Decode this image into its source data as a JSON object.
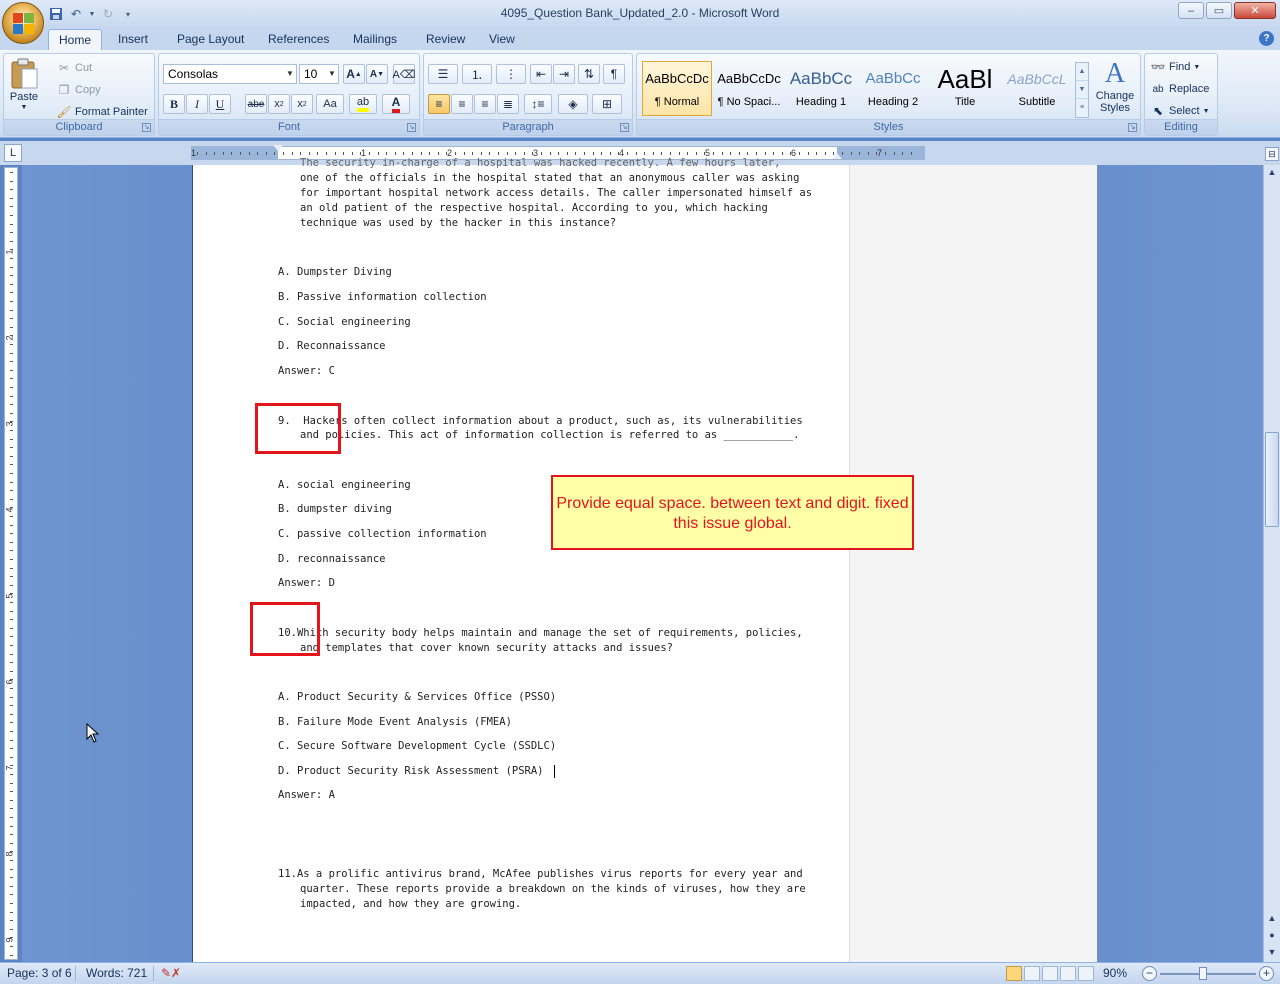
{
  "window": {
    "title": "4095_Question Bank_Updated_2.0 - Microsoft Word",
    "controls": {
      "minimize": "–",
      "restore": "▭",
      "close": "✕"
    }
  },
  "tabs": [
    {
      "label": "Home",
      "active": true
    },
    {
      "label": "Insert"
    },
    {
      "label": "Page Layout"
    },
    {
      "label": "References"
    },
    {
      "label": "Mailings"
    },
    {
      "label": "Review"
    },
    {
      "label": "View"
    }
  ],
  "ribbon": {
    "clipboard": {
      "group_label": "Clipboard",
      "paste": "Paste",
      "cut": "Cut",
      "copy": "Copy",
      "format_painter": "Format Painter"
    },
    "font": {
      "group_label": "Font",
      "font_name": "Consolas",
      "font_size": "10"
    },
    "paragraph": {
      "group_label": "Paragraph"
    },
    "styles": {
      "group_label": "Styles",
      "items": [
        {
          "sample": "AaBbCcDc",
          "name": "¶ Normal",
          "selected": true
        },
        {
          "sample": "AaBbCcDc",
          "name": "¶ No Spaci..."
        },
        {
          "sample": "AaBbCc",
          "name": "Heading 1"
        },
        {
          "sample": "AaBbCc",
          "name": "Heading 2"
        },
        {
          "sample": "AaBl",
          "name": "Title"
        },
        {
          "sample": "AaBbCcL",
          "name": "Subtitle"
        }
      ],
      "change_styles": "Change Styles"
    },
    "editing": {
      "group_label": "Editing",
      "find": "Find",
      "replace": "Replace",
      "select": "Select"
    }
  },
  "ruler": {
    "numbers": [
      "1",
      "1",
      "2",
      "3",
      "4",
      "5",
      "6",
      "7"
    ]
  },
  "document": {
    "q8_lines": [
      "one of the officials in the hospital stated that an anonymous caller was asking",
      "for important hospital network access details. The caller impersonated himself as",
      "an old patient of the respective hospital. According to you, which hacking",
      "technique was used by the hacker in this instance?"
    ],
    "q8_options": [
      "A. Dumpster Diving",
      "B. Passive information collection",
      "C. Social engineering",
      "D. Reconnaissance"
    ],
    "q8_answer": "Answer: C",
    "q9_line1": "9.  Hackers often collect information about a product, such as, its vulnerabilities",
    "q9_line2": "and policies. This act of information collection is referred to as ___________.",
    "q9_options": [
      "A. social engineering",
      "B. dumpster diving",
      "C. passive collection information",
      "D. reconnaissance"
    ],
    "q9_answer": "Answer: D",
    "q10_line1": "10.Which security body helps maintain and manage the set of requirements, policies,",
    "q10_line2": "and templates that cover known security attacks and issues?",
    "q10_options": [
      "A. Product Security & Services Office (PSSO)",
      "B. Failure Mode Event Analysis (FMEA)",
      "C. Secure Software Development Cycle (SSDLC)",
      "D. Product Security Risk Assessment (PSRA)"
    ],
    "q10_answer": "Answer: A",
    "q11_line1": "11.As a prolific antivirus brand, McAfee publishes virus reports for every year and",
    "q11_line2": "quarter. These reports provide a breakdown on the kinds of viruses, how they are",
    "q11_line3": "impacted, and how they are growing."
  },
  "comment": {
    "text": "Provide equal space. between text and digit. fixed this issue global."
  },
  "status": {
    "page": "Page: 3 of 6",
    "words": "Words: 721",
    "zoom": "90%"
  },
  "colors": {
    "annotation_red": "#e4141b",
    "comment_bg": "#ffffa8",
    "ribbon_blue": "#c5d7ef"
  }
}
